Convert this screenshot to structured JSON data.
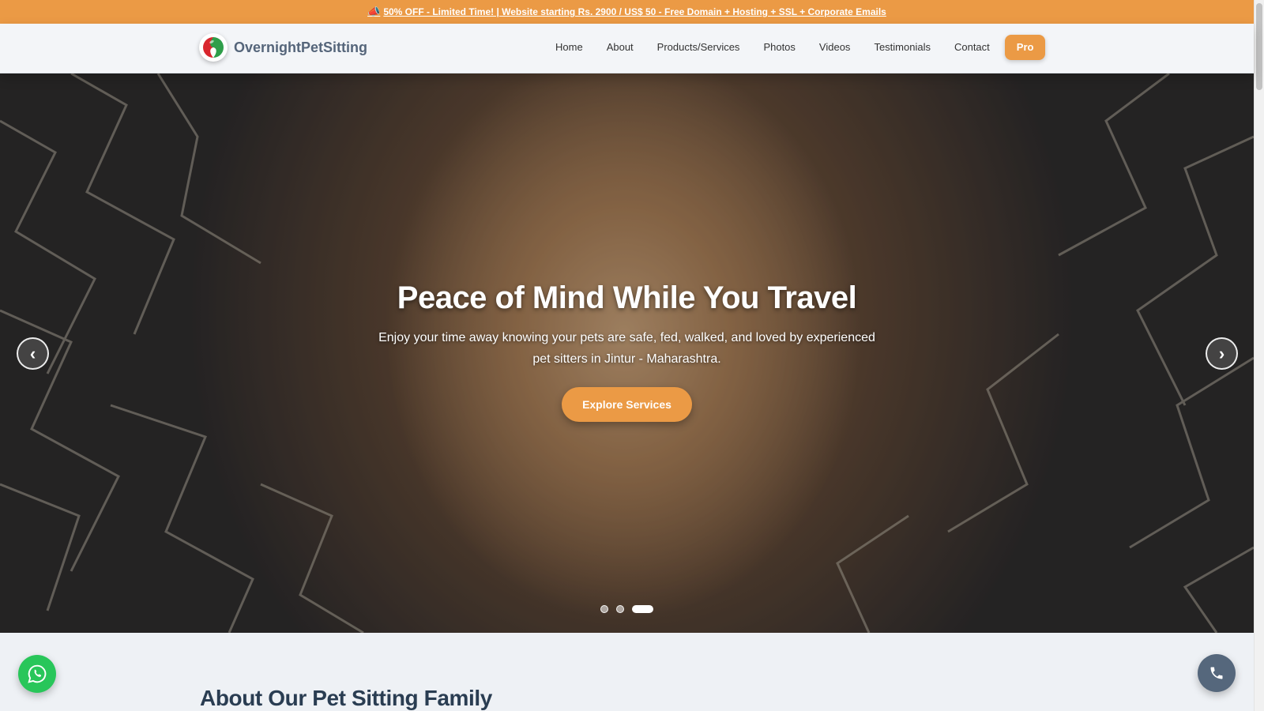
{
  "promo": {
    "icon": "megaphone-icon",
    "text": "50% OFF - Limited Time! | Website starting Rs. 2900 / US$ 50 - Free Domain + Hosting + SSL + Corporate Emails"
  },
  "brand": {
    "name": "OvernightPetSitting",
    "colors": {
      "red": "#d9262e",
      "green": "#2f9e4a"
    }
  },
  "nav": {
    "items": [
      {
        "label": "Home"
      },
      {
        "label": "About"
      },
      {
        "label": "Products/Services"
      },
      {
        "label": "Photos"
      },
      {
        "label": "Videos"
      },
      {
        "label": "Testimonials"
      },
      {
        "label": "Contact"
      }
    ],
    "pro_label": "Pro"
  },
  "hero": {
    "title": "Peace of Mind While You Travel",
    "subtitle": "Enjoy your time away knowing your pets are safe, fed, walked, and loved by experienced pet sitters in Jintur - Maharashtra.",
    "button_label": "Explore Services",
    "prev_icon": "chevron-left-icon",
    "next_icon": "chevron-right-icon",
    "slides_total": 3,
    "active_slide": 3
  },
  "about": {
    "title": "About Our Pet Sitting Family"
  },
  "floating": {
    "whatsapp_icon": "whatsapp-icon",
    "phone_icon": "phone-icon"
  },
  "theme": {
    "accent": "#eb9a45",
    "heading": "#2a3d52",
    "whatsapp": "#28c65a"
  }
}
